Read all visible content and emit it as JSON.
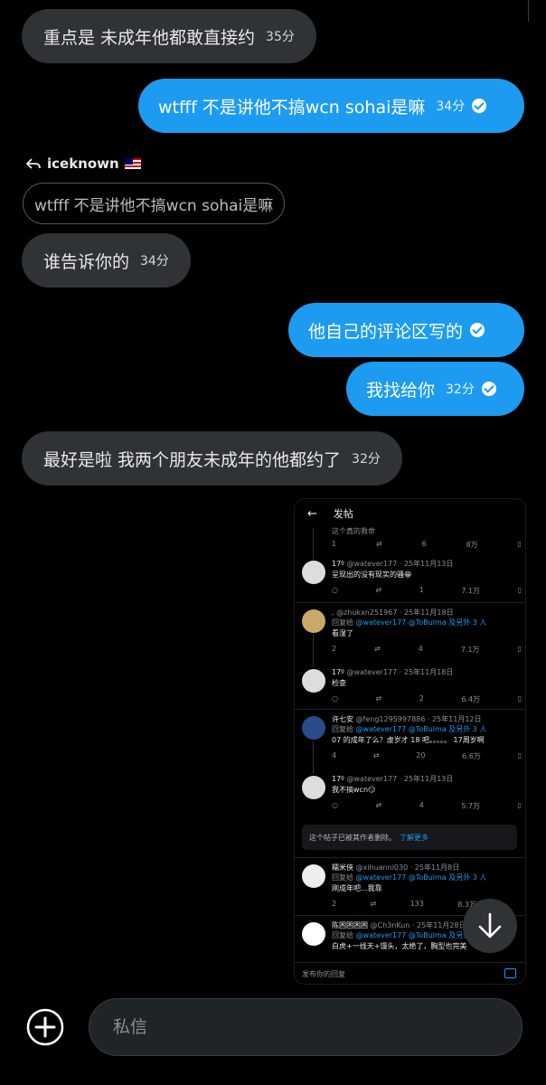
{
  "messages": [
    {
      "text": "重点是 未成年他都敢直接约",
      "time": "35分"
    },
    {
      "text": "wtfff 不是讲他不搞wcn sohai是嘛",
      "time": "34分"
    },
    {
      "reply_user": "iceknown",
      "quote": "wtfff 不是讲他不搞wcn sohai是嘛"
    },
    {
      "text": "谁告诉你的",
      "time": "34分"
    },
    {
      "text": "他自己的评论区写的",
      "time": ""
    },
    {
      "text": "我找给你",
      "time": "32分"
    },
    {
      "text": "最好是啦 我两个朋友未成年的他都约了",
      "time": "32分"
    }
  ],
  "screenshot": {
    "title": "发帖",
    "top_cut_text": "这个真的救命",
    "top_stats": {
      "reply": "1",
      "like": "6",
      "views": "8万"
    },
    "deleted_notice": "这个帖子已被其作者删除。",
    "learn_more": "了解更多",
    "reply_placeholder": "发布你的回复",
    "posts": [
      {
        "name": "17º",
        "handle": "@watever177 · 25年11月13日",
        "replying": "",
        "replying_to": "",
        "text": "呈现出的没有现实的骚😁",
        "reply": "",
        "retweet": "",
        "like": "1",
        "views": "7.1万"
      },
      {
        "name": ".",
        "handle": "@zhukxn251967 · 25年11月18日",
        "replying": "回复给",
        "replying_to": "@watever177 @ToBulma 及另外 3 人",
        "text": "看湿了",
        "reply": "2",
        "retweet": "",
        "like": "4",
        "views": "7.1万"
      },
      {
        "name": "17º",
        "handle": "@watever177 · 25年11月18日",
        "replying": "",
        "replying_to": "",
        "text": "检查",
        "reply": "",
        "retweet": "",
        "like": "2",
        "views": "6.4万"
      },
      {
        "name": "许七安",
        "handle": "@feng1295997886 · 25年11月12日",
        "replying": "回复给",
        "replying_to": "@watever177 @ToBulma 及另外 3 人",
        "text": "07 的成年了么？虚岁才 18 吧。。。。。 17周岁啊",
        "reply": "4",
        "retweet": "",
        "like": "20",
        "views": "6.6万"
      },
      {
        "name": "17º",
        "handle": "@watever177 · 25年11月13日",
        "replying": "",
        "replying_to": "",
        "text": "我不搞wcn😏",
        "reply": "",
        "retweet": "",
        "like": "4",
        "views": "5.7万"
      },
      {
        "name": "糯米侠",
        "handle": "@xihuanni030 · 25年11月8日",
        "replying": "回复给",
        "replying_to": "@watever177 @ToBulma 及另外 3 人",
        "text": "刚成年吧...我靠",
        "reply": "2",
        "retweet": "",
        "like": "133",
        "views": "8.3万"
      },
      {
        "name": "陈困困困困",
        "handle": "@Ch3nKun · 25年11月28日",
        "replying": "回复给",
        "replying_to": "@watever177 @ToBulma 及另外",
        "text": "白虎+一线天+馒头，太绝了，胸型也完美",
        "reply": "",
        "retweet": "",
        "like": "",
        "views": ""
      }
    ]
  },
  "composer": {
    "placeholder": "私信"
  },
  "colors": {
    "accent": "#1d9bf0",
    "incoming": "#2f3336",
    "background": "#000000"
  }
}
